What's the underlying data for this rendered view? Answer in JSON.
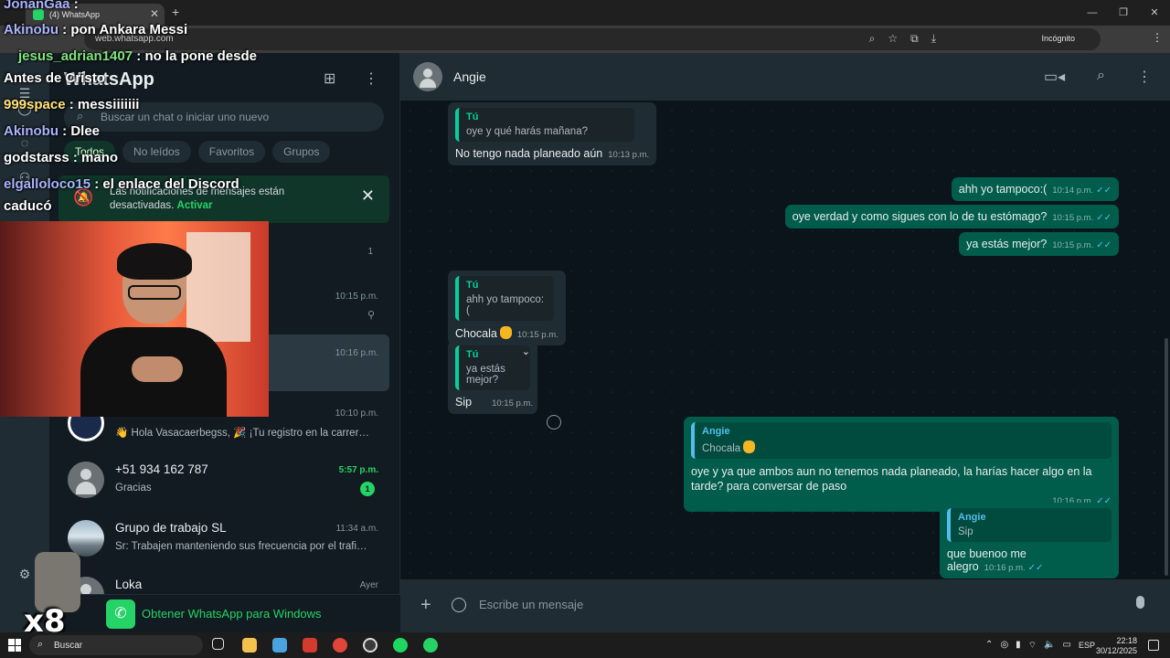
{
  "browser": {
    "tab_title": "(4) WhatsApp",
    "url": "web.whatsapp.com",
    "mode_label": "Incógnito"
  },
  "sidebar": {
    "title": "WhatsApp",
    "search_placeholder": "Buscar un chat o iniciar uno nuevo",
    "filters": [
      "Todos",
      "No leídos",
      "Favoritos",
      "Grupos"
    ],
    "notification": {
      "text": "Las notificaciones de mensajes están desactivadas.",
      "action": "Activar"
    },
    "chats": [
      {
        "count": "1"
      },
      {
        "time": "10:15 p.m."
      },
      {
        "time": "10:16 p.m."
      },
      {
        "time": "10:10 p.m.",
        "preview": "👋 Hola Vasacaerbegss, 🎉 ¡Tu registro en la carrer…"
      },
      {
        "name": "+51 934 162 787",
        "time": "5:57 p.m.",
        "preview": "Gracias",
        "badge": "1"
      },
      {
        "name": "Grupo de trabajo SL",
        "time": "11:34 a.m.",
        "preview": "Sr: Trabajen manteniendo sus frecuencia por el trafi…"
      },
      {
        "name": "Loka",
        "time": "Ayer"
      }
    ],
    "get_app": "Obtener WhatsApp para Windows"
  },
  "conversation": {
    "contact": "Angie",
    "messages": [
      {
        "quote_author": "Tú",
        "quote_text": "oye y qué harás mañana?",
        "text": "No tengo nada planeado aún",
        "time": "10:13 p.m."
      },
      {
        "text": "ahh yo tampoco:(",
        "time": "10:14 p.m."
      },
      {
        "text": "oye verdad y como sigues con lo de tu estómago?",
        "time": "10:15 p.m."
      },
      {
        "text": "ya estás mejor?",
        "time": "10:15 p.m."
      },
      {
        "quote_author": "Tú",
        "quote_text": "ahh yo tampoco:(",
        "text": "Chocala",
        "time": "10:15 p.m."
      },
      {
        "quote_author": "Tú",
        "quote_text": "ya estás mejor?",
        "text": "Sip",
        "time": "10:15 p.m."
      },
      {
        "quote_author": "Angie",
        "quote_text": "Chocala",
        "text": "oye y ya que ambos aun no tenemos nada planeado, la harías hacer algo en la tarde? para conversar de paso",
        "time": "10:16 p.m."
      },
      {
        "quote_author": "Angie",
        "quote_text": "Sip",
        "text": "que buenoo me alegro",
        "time": "10:16 p.m."
      }
    ],
    "composer_placeholder": "Escribe un mensaje"
  },
  "stream_chat": [
    {
      "user": "JonanGaa",
      "msg": ""
    },
    {
      "user": "Akinobu",
      "msg": "pon Ankara Messi"
    },
    {
      "user": "jesus_adrian1407",
      "msg": "no la pone desde"
    },
    {
      "user": "",
      "msg": "Antes de Cristo"
    },
    {
      "user": "999space",
      "msg": "messiiiiiii"
    },
    {
      "user": "Akinobu",
      "msg": "Dlee"
    },
    {
      "user": "godstarss",
      "msg": "mano"
    },
    {
      "user": "elgalloloco15",
      "msg": "el enlace del Discord"
    },
    {
      "user": "",
      "msg": "caducó"
    }
  ],
  "overlay": {
    "multiplier": "x8"
  },
  "taskbar": {
    "search_label": "Buscar",
    "lang": "ESP",
    "time": "22:18",
    "date": "30/12/2025"
  },
  "colors": {
    "accent": "#25d366",
    "outgoing_bubble": "#005c4b",
    "incoming_bubble": "#202c33",
    "panel": "#111b21"
  }
}
